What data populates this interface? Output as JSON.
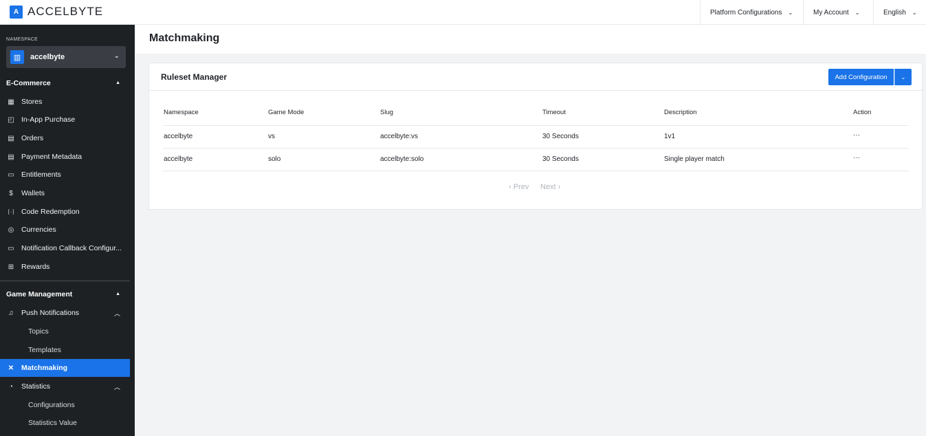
{
  "app": {
    "brand": "ACCELBYTE",
    "logo_glyph": "A"
  },
  "topnav": {
    "platform": "Platform Configurations",
    "account": "My Account",
    "language": "English"
  },
  "sidebar": {
    "namespace_label": "NAMESPACE",
    "namespace_value": "accelbyte",
    "ecommerce_title": "E-Commerce",
    "ecommerce_items": [
      {
        "label": "Stores",
        "icon": "store-icon",
        "glyph": "▦"
      },
      {
        "label": "In-App Purchase",
        "icon": "bag-icon",
        "glyph": "◰"
      },
      {
        "label": "Orders",
        "icon": "orders-icon",
        "glyph": "▤"
      },
      {
        "label": "Payment Metadata",
        "icon": "document-icon",
        "glyph": "▤"
      },
      {
        "label": "Entitlements",
        "icon": "entitlement-icon",
        "glyph": "▭"
      },
      {
        "label": "Wallets",
        "icon": "dollar-icon",
        "glyph": "$"
      },
      {
        "label": "Code Redemption",
        "icon": "code-icon",
        "glyph": "[··]"
      },
      {
        "label": "Currencies",
        "icon": "currency-icon",
        "glyph": "◎"
      },
      {
        "label": "Notification Callback Configur...",
        "icon": "callback-icon",
        "glyph": "▭"
      },
      {
        "label": "Rewards",
        "icon": "gift-icon",
        "glyph": "⊞"
      }
    ],
    "game_title": "Game Management",
    "push_notifications": "Push Notifications",
    "push_sub": [
      "Topics",
      "Templates"
    ],
    "matchmaking": "Matchmaking",
    "statistics": "Statistics",
    "statistics_sub": [
      "Configurations",
      "Statistics Value"
    ]
  },
  "main": {
    "title": "Matchmaking",
    "card_title": "Ruleset Manager",
    "add_button": "Add Configuration",
    "columns": [
      "Namespace",
      "Game Mode",
      "Slug",
      "Timeout",
      "Description",
      "Action"
    ],
    "rows": [
      [
        "accelbyte",
        "vs",
        "accelbyte:vs",
        "30 Seconds",
        "1v1",
        "···"
      ],
      [
        "accelbyte",
        "solo",
        "accelbyte:solo",
        "30 Seconds",
        "Single player match",
        "···"
      ]
    ],
    "pager": {
      "prev": "‹ Prev",
      "next": "Next ›"
    }
  },
  "colors": {
    "accent": "#1a73e8",
    "sidebar": "#1e2124"
  }
}
